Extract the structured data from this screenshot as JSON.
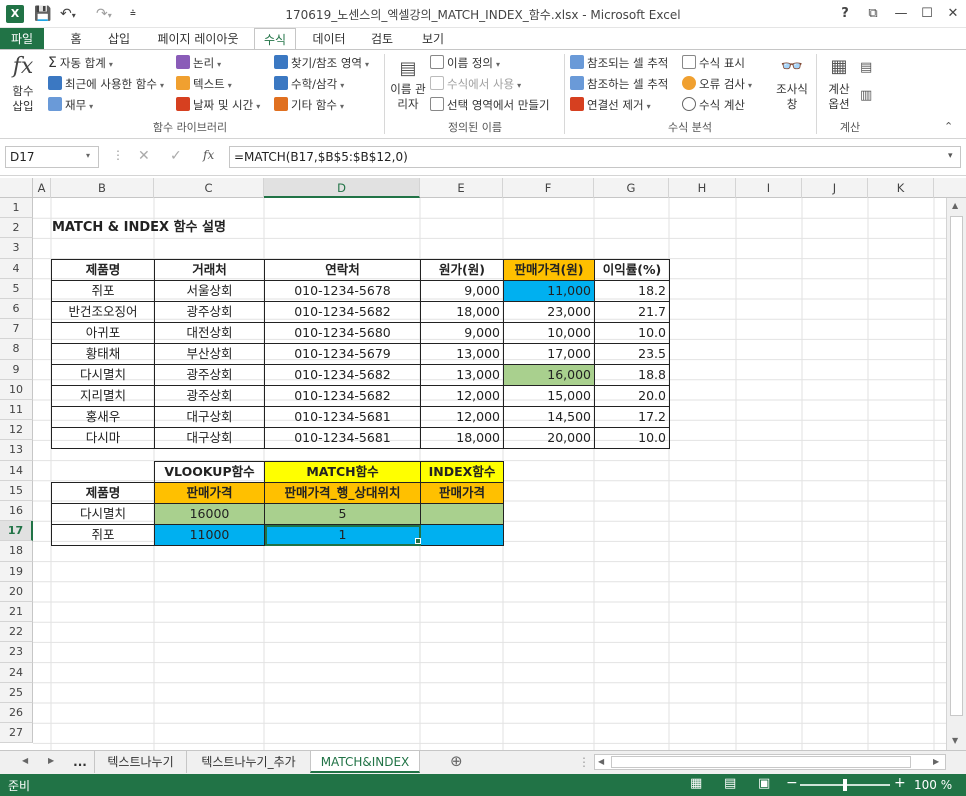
{
  "window": {
    "title": "170619_노센스의_엑셀강의_MATCH_INDEX_함수.xlsx - Microsoft Excel",
    "help": "?",
    "buttons": [
      "?",
      "⧉",
      "—",
      "☐",
      "✕"
    ]
  },
  "ribbon_tabs": [
    "파일",
    "홈",
    "삽입",
    "페이지 레이아웃",
    "수식",
    "데이터",
    "검토",
    "보기"
  ],
  "ribbon": {
    "insert_function": "함수 삽입",
    "lib": {
      "autosum": "자동 합계",
      "recent": "최근에 사용한 함수",
      "finance": "재무",
      "logic": "논리",
      "text": "텍스트",
      "datetime": "날짜 및 시간",
      "lookup": "찾기/참조 영역",
      "math": "수학/삼각",
      "more": "기타 함수",
      "label": "함수 라이브러리"
    },
    "names": {
      "manager": "이름 관리자",
      "define": "이름 정의",
      "use_in_formula": "수식에서 사용",
      "create_from_sel": "선택 영역에서 만들기",
      "label": "정의된 이름"
    },
    "audit": {
      "trace_precedents": "참조되는 셀 추적",
      "trace_dependents": "참조하는 셀 추적",
      "remove_arrows": "연결선 제거",
      "show_formulas": "수식 표시",
      "error_check": "오류 검사",
      "evaluate": "수식 계산",
      "watch": "조사식 창",
      "label": "수식 분석"
    },
    "calc": {
      "options": "계산 옵션",
      "label": "계산"
    }
  },
  "formula_bar": {
    "name_box": "D17",
    "formula": "=MATCH(B17,$B$5:$B$12,0)"
  },
  "columns": [
    "A",
    "B",
    "C",
    "D",
    "E",
    "F",
    "G",
    "H",
    "I",
    "J",
    "K"
  ],
  "rows": [
    "1",
    "2",
    "3",
    "4",
    "5",
    "6",
    "7",
    "8",
    "9",
    "10",
    "11",
    "12",
    "13",
    "14",
    "15",
    "16",
    "17",
    "18",
    "19",
    "20",
    "21",
    "22",
    "23",
    "24",
    "25",
    "26",
    "27"
  ],
  "sheet": {
    "title": "MATCH & INDEX 함수 설명",
    "table_headers": [
      "제품명",
      "거래처",
      "연락처",
      "원가(원)",
      "판매가격(원)",
      "이익률(%)"
    ],
    "table_rows": [
      [
        "쥐포",
        "서울상회",
        "010-1234-5678",
        "9,000",
        "11,000",
        "18.2"
      ],
      [
        "반건조오징어",
        "광주상회",
        "010-1234-5682",
        "18,000",
        "23,000",
        "21.7"
      ],
      [
        "아귀포",
        "대전상회",
        "010-1234-5680",
        "9,000",
        "10,000",
        "10.0"
      ],
      [
        "황태채",
        "부산상회",
        "010-1234-5679",
        "13,000",
        "17,000",
        "23.5"
      ],
      [
        "다시멸치",
        "광주상회",
        "010-1234-5682",
        "13,000",
        "16,000",
        "18.8"
      ],
      [
        "지리멸치",
        "광주상회",
        "010-1234-5682",
        "12,000",
        "15,000",
        "20.0"
      ],
      [
        "홍새우",
        "대구상회",
        "010-1234-5681",
        "12,000",
        "14,500",
        "17.2"
      ],
      [
        "다시마",
        "대구상회",
        "010-1234-5681",
        "18,000",
        "20,000",
        "10.0"
      ]
    ],
    "lookup": {
      "head1": [
        "VLOOKUP함수",
        "MATCH함수",
        "INDEX함수"
      ],
      "head2": [
        "제품명",
        "판매가격",
        "판매가격_행_상대위치",
        "판매가격"
      ],
      "rows": [
        [
          "다시멸치",
          "16000",
          "5",
          ""
        ],
        [
          "쥐포",
          "11000",
          "1",
          ""
        ]
      ]
    }
  },
  "sheet_tabs": [
    "...",
    "텍스트나누기",
    "텍스트나누기_추가",
    "MATCH&INDEX"
  ],
  "status": {
    "ready": "준비",
    "zoom": "100 %",
    "zoom_level": 1.0
  },
  "colors": {
    "excel_green": "#217346",
    "header_orange": "#ffc000",
    "header_yellow": "#ffff00",
    "cell_blue": "#00b0f0",
    "cell_green": "#a9d08e"
  }
}
